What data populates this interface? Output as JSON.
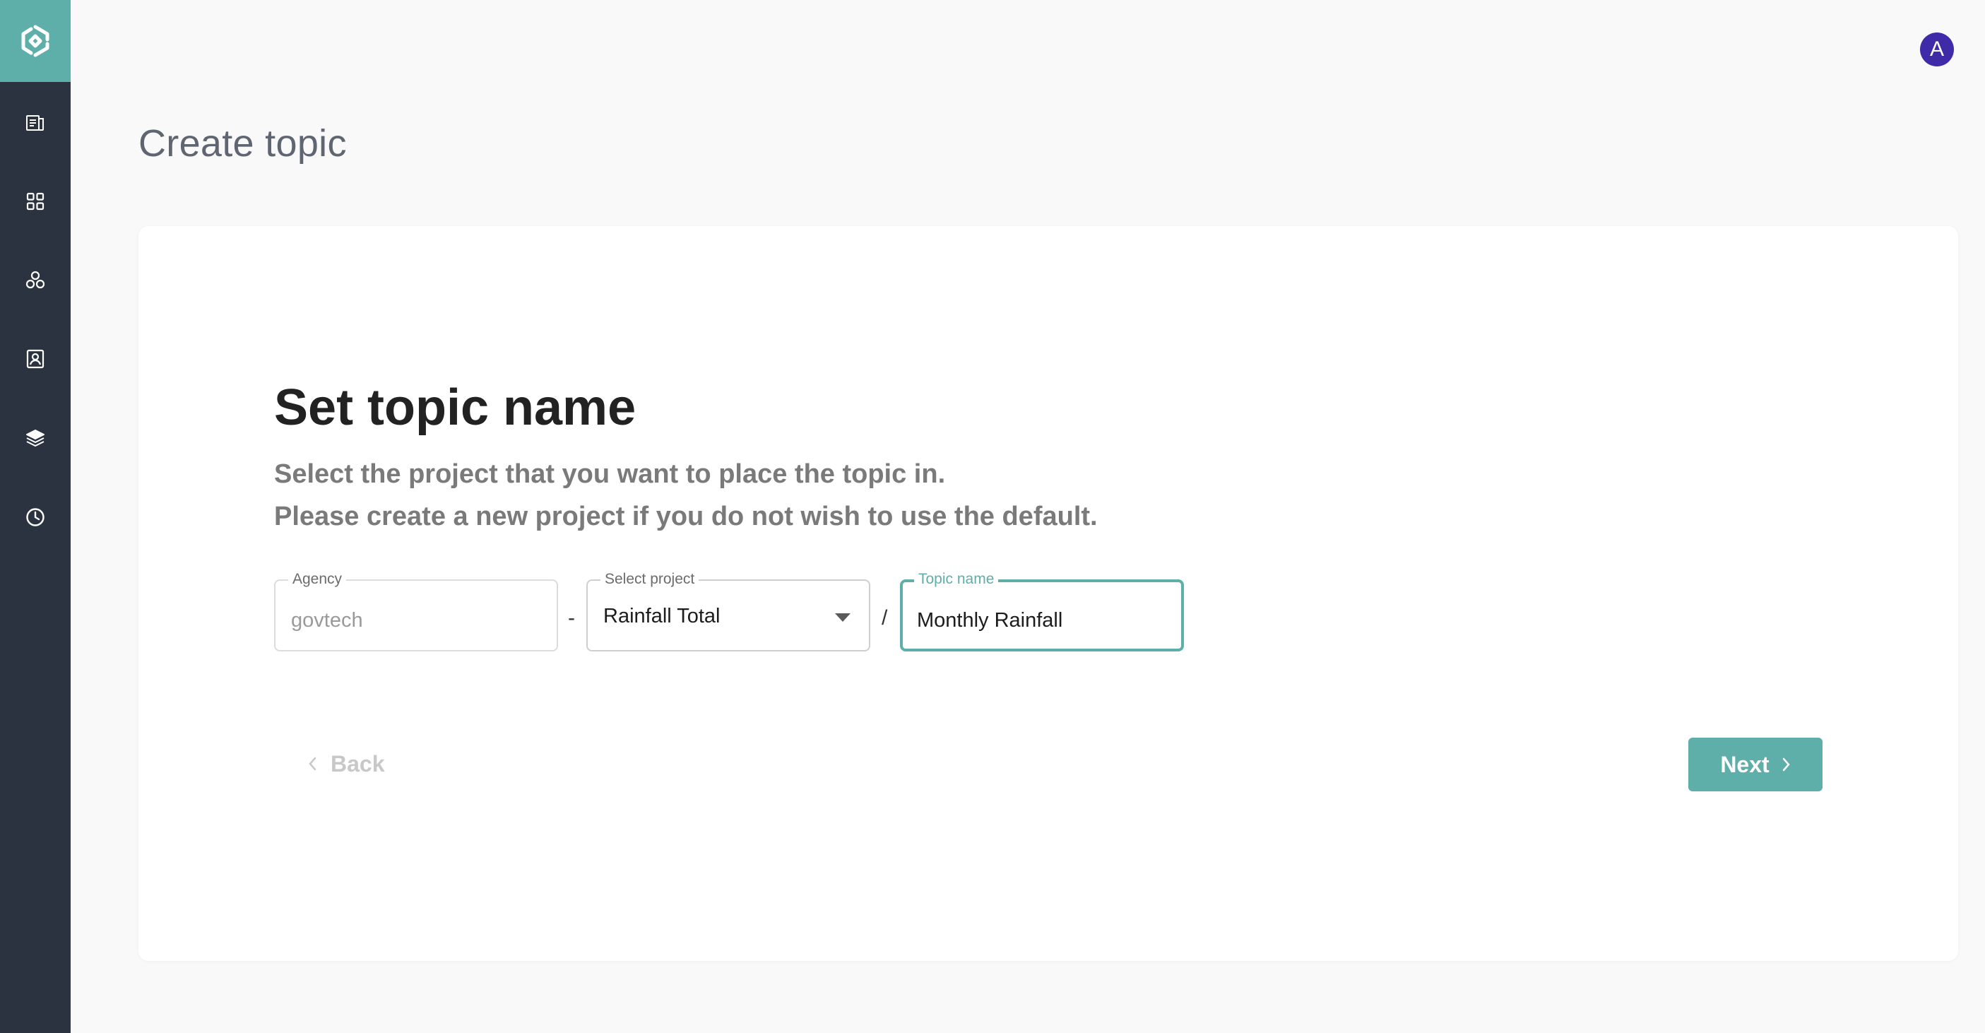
{
  "app": {
    "logo_icon": "hexagon-logo-icon",
    "avatar_initial": "A",
    "avatar_color": "#3f2aa8",
    "accent": "#5eaea9",
    "sidebar_color": "#2c3340"
  },
  "sidebar": {
    "items": [
      {
        "icon": "catalog-icon"
      },
      {
        "icon": "grid-icon"
      },
      {
        "icon": "network-icon"
      },
      {
        "icon": "contact-card-icon"
      },
      {
        "icon": "layers-icon"
      },
      {
        "icon": "history-icon"
      }
    ]
  },
  "page": {
    "title": "Create topic"
  },
  "form": {
    "heading": "Set topic name",
    "description_line1": "Select the project that you want to place the topic in.",
    "description_line2": "Please create a new project if you do not wish to use the default.",
    "agency": {
      "label": "Agency",
      "value": "govtech"
    },
    "separator1": "-",
    "project": {
      "label": "Select project",
      "value": "Rainfall Total"
    },
    "separator2": "/",
    "topic": {
      "label": "Topic name",
      "value": "Monthly Rainfall"
    }
  },
  "actions": {
    "back_label": "Back",
    "next_label": "Next"
  }
}
